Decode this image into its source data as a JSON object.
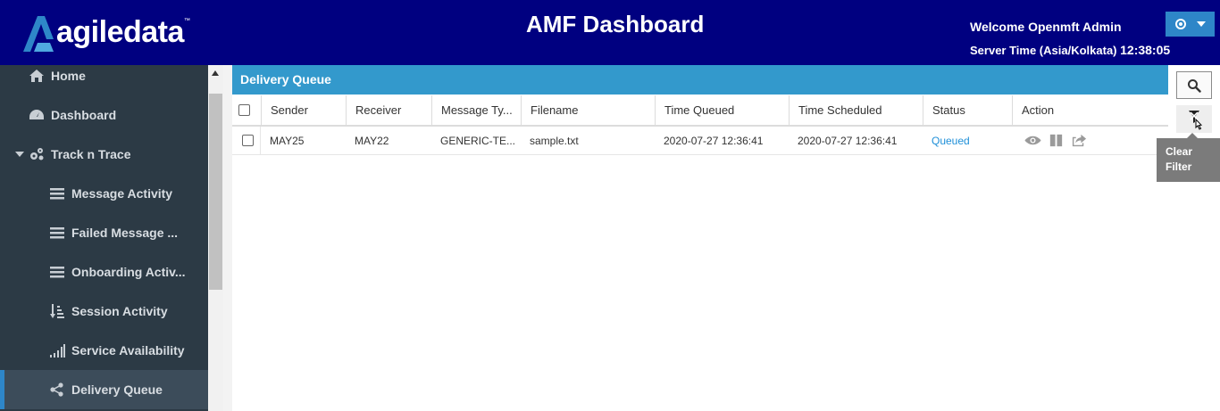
{
  "header": {
    "logo_text": "agiledata",
    "logo_tm": "™",
    "title": "AMF Dashboard",
    "welcome": "Welcome Openmft Admin",
    "server_time_label": "Server Time (Asia/Kolkata)",
    "server_time_value": "12:38:05",
    "user_menu_icon": "user-gear-icon",
    "brand_color": "#000080",
    "accent_color": "#2e86c8"
  },
  "sidebar": {
    "items": [
      {
        "label": "Home",
        "icon": "home-icon"
      },
      {
        "label": "Dashboard",
        "icon": "dashboard-icon"
      },
      {
        "label": "Track n Trace",
        "icon": "gears-icon",
        "expanded": true
      },
      {
        "label": "Message Activity",
        "icon": "list-icon"
      },
      {
        "label": "Failed Message ...",
        "icon": "list-icon"
      },
      {
        "label": "Onboarding Activ...",
        "icon": "list-icon"
      },
      {
        "label": "Session Activity",
        "icon": "sort-icon"
      },
      {
        "label": "Service Availability",
        "icon": "signal-icon"
      },
      {
        "label": "Delivery Queue",
        "icon": "share-icon",
        "active": true
      }
    ]
  },
  "panel": {
    "title": "Delivery Queue",
    "header_color": "#3399cc"
  },
  "table": {
    "columns": [
      "Sender",
      "Receiver",
      "Message Ty...",
      "Filename",
      "Time Queued",
      "Time Scheduled",
      "Status",
      "Action"
    ],
    "rows": [
      {
        "sender": "MAY25",
        "receiver": "MAY22",
        "message_type": "GENERIC-TE...",
        "filename": "sample.txt",
        "time_queued": "2020-07-27 12:36:41",
        "time_scheduled": "2020-07-27 12:36:41",
        "status": "Queued",
        "actions": [
          "eye-icon",
          "pause-icon",
          "share-forward-icon"
        ]
      }
    ]
  },
  "tools": {
    "search_icon": "search-icon",
    "filter_icon": "clear-filter-icon",
    "tooltip_line1": "Clear",
    "tooltip_line2": "Filter"
  }
}
